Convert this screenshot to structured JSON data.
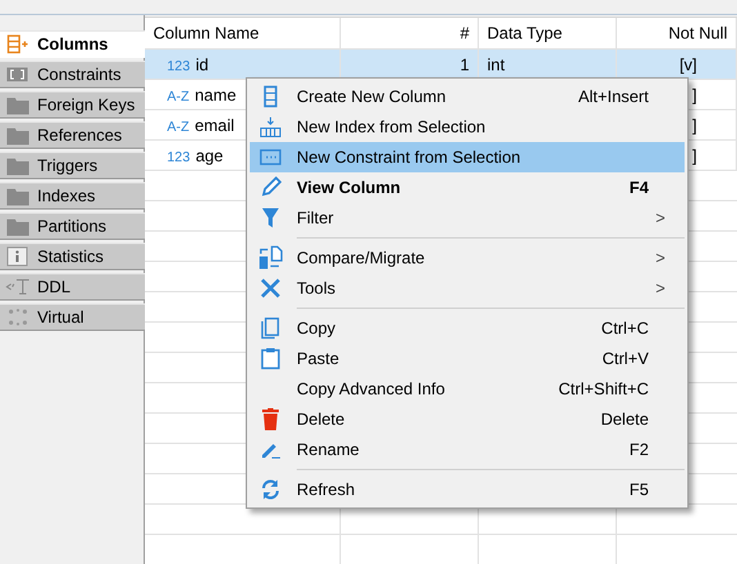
{
  "side_tabs": [
    {
      "label": "Columns",
      "selected": true
    },
    {
      "label": "Constraints",
      "selected": false
    },
    {
      "label": "Foreign Keys",
      "selected": false
    },
    {
      "label": "References",
      "selected": false
    },
    {
      "label": "Triggers",
      "selected": false
    },
    {
      "label": "Indexes",
      "selected": false
    },
    {
      "label": "Partitions",
      "selected": false
    },
    {
      "label": "Statistics",
      "selected": false
    },
    {
      "label": "DDL",
      "selected": false
    },
    {
      "label": "Virtual",
      "selected": false
    }
  ],
  "table": {
    "columns": [
      "Column Name",
      "#",
      "Data Type",
      "Not Null"
    ],
    "rows": [
      {
        "type_badge": "123",
        "name": "id",
        "number": "1",
        "data_type": "int",
        "not_null": "[v]",
        "selected": true
      },
      {
        "type_badge": "A-Z",
        "name": "name",
        "not_null": "]",
        "selected": false
      },
      {
        "type_badge": "A-Z",
        "name": "email",
        "not_null": "]",
        "selected": false
      },
      {
        "type_badge": "123",
        "name": "age",
        "not_null": "]",
        "selected": false
      }
    ]
  },
  "context_menu": [
    {
      "kind": "item",
      "label": "Create New Column",
      "shortcut": "Alt+Insert",
      "default": false,
      "selected": false
    },
    {
      "kind": "item",
      "label": "New Index from Selection",
      "default": false,
      "selected": false
    },
    {
      "kind": "item",
      "label": "New Constraint from Selection",
      "default": false,
      "selected": true
    },
    {
      "kind": "item",
      "label": "View Column",
      "shortcut": "F4",
      "default": true,
      "selected": false
    },
    {
      "kind": "item",
      "label": "Filter",
      "arrow": ">",
      "default": false,
      "selected": false
    },
    {
      "kind": "separator"
    },
    {
      "kind": "item",
      "label": "Compare/Migrate",
      "arrow": ">",
      "default": false,
      "selected": false
    },
    {
      "kind": "item",
      "label": "Tools",
      "arrow": ">",
      "default": false,
      "selected": false
    },
    {
      "kind": "separator"
    },
    {
      "kind": "item",
      "label": "Copy",
      "shortcut": "Ctrl+C",
      "default": false,
      "selected": false
    },
    {
      "kind": "item",
      "label": "Paste",
      "shortcut": "Ctrl+V",
      "default": false,
      "selected": false
    },
    {
      "kind": "item",
      "label": "Copy Advanced Info",
      "shortcut": "Ctrl+Shift+C",
      "default": false,
      "selected": false
    },
    {
      "kind": "item",
      "label": "Delete",
      "shortcut": "Delete",
      "default": false,
      "selected": false
    },
    {
      "kind": "item",
      "label": "Rename",
      "shortcut": "F2",
      "default": false,
      "selected": false
    },
    {
      "kind": "separator"
    },
    {
      "kind": "item",
      "label": "Refresh",
      "shortcut": "F5",
      "default": false,
      "selected": false
    }
  ]
}
